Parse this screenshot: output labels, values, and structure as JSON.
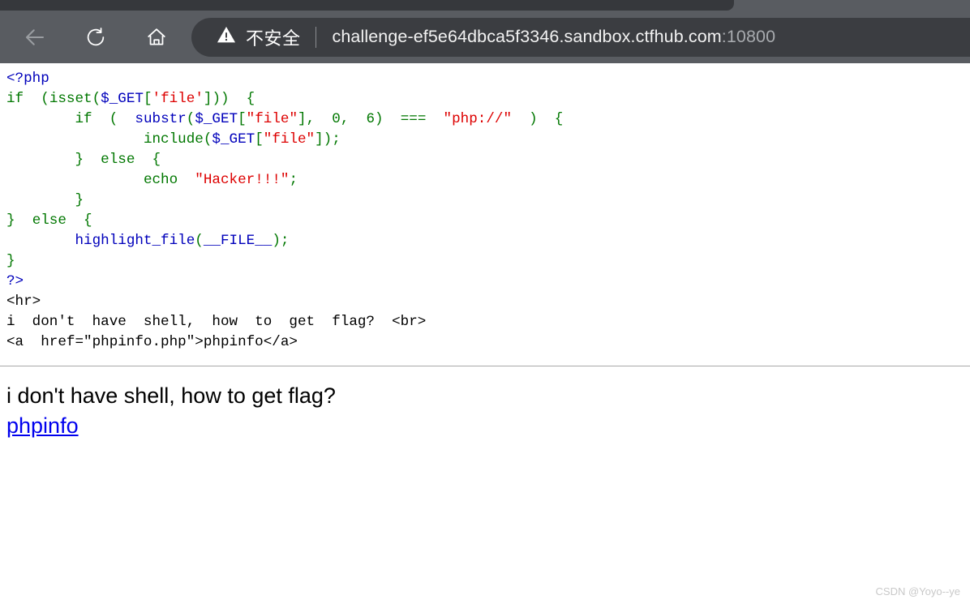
{
  "browser": {
    "back_label": "Back",
    "reload_label": "Reload",
    "home_label": "Home",
    "security_label": "不安全",
    "url_host": "challenge-ef5e64dbca5f3346.sandbox.ctfhub.com",
    "url_port": ":10800",
    "colors": {
      "toolbar_bg": "#595c61",
      "tabstrip_bg": "#36383c",
      "omnibox_bg": "#3b3d41",
      "url_text": "#f2f2f2",
      "url_port_text": "#a7aaae"
    }
  },
  "source_view": {
    "lines": [
      {
        "indent": "",
        "tokens": [
          {
            "t": "<?php",
            "c": "default"
          }
        ]
      },
      {
        "indent": "",
        "tokens": [
          {
            "t": "if",
            "c": "keyword"
          },
          {
            "t": "  (",
            "c": "keyword"
          },
          {
            "t": "isset",
            "c": "keyword"
          },
          {
            "t": "(",
            "c": "keyword"
          },
          {
            "t": "$_GET",
            "c": "var"
          },
          {
            "t": "[",
            "c": "keyword"
          },
          {
            "t": "'file'",
            "c": "string"
          },
          {
            "t": "]))  {",
            "c": "keyword"
          }
        ]
      },
      {
        "indent": "        ",
        "tokens": [
          {
            "t": "if",
            "c": "keyword"
          },
          {
            "t": "  (  ",
            "c": "keyword"
          },
          {
            "t": "substr",
            "c": "var"
          },
          {
            "t": "(",
            "c": "keyword"
          },
          {
            "t": "$_GET",
            "c": "var"
          },
          {
            "t": "[",
            "c": "keyword"
          },
          {
            "t": "\"file\"",
            "c": "string"
          },
          {
            "t": "],  0,  6)  ",
            "c": "keyword"
          },
          {
            "t": "===",
            "c": "keyword"
          },
          {
            "t": "  ",
            "c": "keyword"
          },
          {
            "t": "\"php://\"",
            "c": "string"
          },
          {
            "t": "  )  {",
            "c": "keyword"
          }
        ]
      },
      {
        "indent": "                ",
        "tokens": [
          {
            "t": "include",
            "c": "keyword"
          },
          {
            "t": "(",
            "c": "keyword"
          },
          {
            "t": "$_GET",
            "c": "var"
          },
          {
            "t": "[",
            "c": "keyword"
          },
          {
            "t": "\"file\"",
            "c": "string"
          },
          {
            "t": "]);",
            "c": "keyword"
          }
        ]
      },
      {
        "indent": "        ",
        "tokens": [
          {
            "t": "}  ",
            "c": "keyword"
          },
          {
            "t": "else",
            "c": "keyword"
          },
          {
            "t": "  {",
            "c": "keyword"
          }
        ]
      },
      {
        "indent": "                ",
        "tokens": [
          {
            "t": "echo",
            "c": "keyword"
          },
          {
            "t": "  ",
            "c": "keyword"
          },
          {
            "t": "\"Hacker!!!\"",
            "c": "string"
          },
          {
            "t": ";",
            "c": "keyword"
          }
        ]
      },
      {
        "indent": "        ",
        "tokens": [
          {
            "t": "}",
            "c": "keyword"
          }
        ]
      },
      {
        "indent": "",
        "tokens": [
          {
            "t": "}  ",
            "c": "keyword"
          },
          {
            "t": "else",
            "c": "keyword"
          },
          {
            "t": "  {",
            "c": "keyword"
          }
        ]
      },
      {
        "indent": "        ",
        "tokens": [
          {
            "t": "highlight_file",
            "c": "var"
          },
          {
            "t": "(",
            "c": "keyword"
          },
          {
            "t": "__FILE__",
            "c": "default"
          },
          {
            "t": ");",
            "c": "keyword"
          }
        ]
      },
      {
        "indent": "",
        "tokens": [
          {
            "t": "}",
            "c": "keyword"
          }
        ]
      },
      {
        "indent": "",
        "tokens": [
          {
            "t": "?>",
            "c": "default"
          }
        ]
      },
      {
        "indent": "",
        "tokens": [
          {
            "t": "<hr>",
            "c": "html"
          }
        ]
      },
      {
        "indent": "",
        "tokens": [
          {
            "t": "i  don't  have  shell,  how  to  get  flag?  <br>",
            "c": "html"
          }
        ]
      },
      {
        "indent": "",
        "tokens": [
          {
            "t": "<a  href=\"phpinfo.php\">phpinfo</a>",
            "c": "html"
          }
        ]
      }
    ]
  },
  "rendered_output": {
    "message": "i don't have shell, how to get flag?",
    "link_label": "phpinfo",
    "link_color": "#0000ee"
  },
  "watermark": {
    "text": "CSDN @Yoyo--ye"
  }
}
